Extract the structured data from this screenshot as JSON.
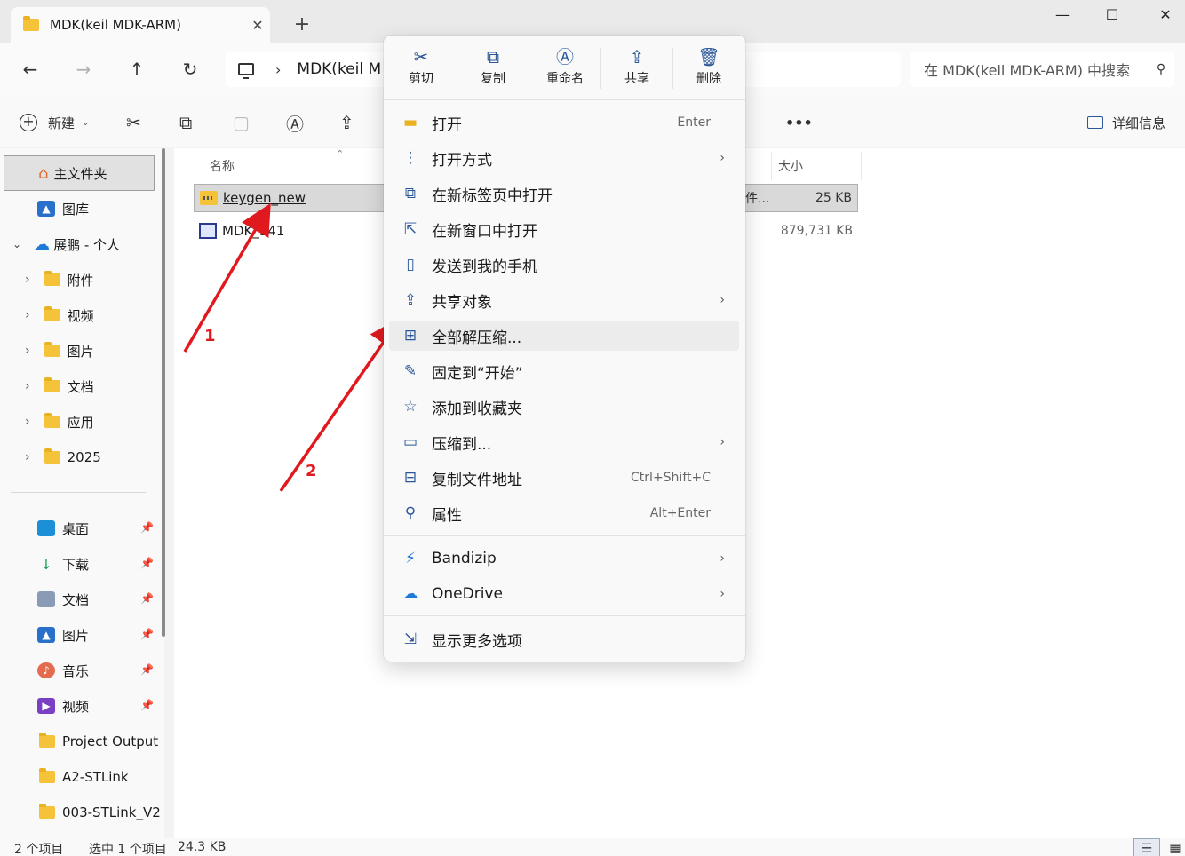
{
  "tab": {
    "title": "MDK(keil MDK-ARM)",
    "close": "✕",
    "new": "+"
  },
  "window": {
    "minimize": "—",
    "maximize": "☐",
    "close": "✕"
  },
  "address": {
    "path": "MDK(keil M",
    "chev": "›",
    "search_placeholder": "在 MDK(keil MDK-ARM) 中搜索"
  },
  "nav": {
    "back": "←",
    "forward": "→",
    "up": "↑",
    "refresh": "↻"
  },
  "commands": {
    "new_label": "新建",
    "more": "•••",
    "details_label": "详细信息"
  },
  "sidebar": {
    "home": "主文件夹",
    "gallery": "图库",
    "onedrive": "展鹏 - 个人",
    "folders": [
      "附件",
      "视频",
      "图片",
      "文档",
      "应用",
      "2025"
    ],
    "quick": [
      "桌面",
      "下载",
      "文档",
      "图片",
      "音乐",
      "视频"
    ],
    "recent": [
      "Project Output",
      "A2-STLink",
      "003-STLink_V2"
    ]
  },
  "columns": {
    "name": "名称",
    "size": "大小"
  },
  "files": [
    {
      "name": "keygen_new",
      "type": "件...",
      "size": "25 KB"
    },
    {
      "name": "MDK_541",
      "type": "",
      "size": "879,731 KB"
    }
  ],
  "status": {
    "count": "2 个项目",
    "selected": "选中 1 个项目",
    "size": "24.3 KB"
  },
  "annotations": {
    "label1": "1",
    "label2": "2"
  },
  "context_menu": {
    "quick_actions": [
      {
        "icon": "✂",
        "label": "剪切"
      },
      {
        "icon": "⧉",
        "label": "复制"
      },
      {
        "icon": "Ⓐ",
        "label": "重命名"
      },
      {
        "icon": "⇪",
        "label": "共享"
      },
      {
        "icon": "🗑",
        "label": "删除"
      }
    ],
    "items": [
      {
        "icon": "▬",
        "label": "打开",
        "shortcut": "Enter",
        "submenu": false
      },
      {
        "icon": "⋮",
        "label": "打开方式",
        "shortcut": "",
        "submenu": true
      },
      {
        "icon": "⧉",
        "label": "在新标签页中打开",
        "shortcut": "",
        "submenu": false
      },
      {
        "icon": "⇱",
        "label": "在新窗口中打开",
        "shortcut": "",
        "submenu": false
      },
      {
        "icon": "▯",
        "label": "发送到我的手机",
        "shortcut": "",
        "submenu": false
      },
      {
        "icon": "⇪",
        "label": "共享对象",
        "shortcut": "",
        "submenu": true
      },
      {
        "icon": "⊞",
        "label": "全部解压缩...",
        "shortcut": "",
        "submenu": false
      },
      {
        "icon": "✎",
        "label": "固定到“开始”",
        "shortcut": "",
        "submenu": false
      },
      {
        "icon": "☆",
        "label": "添加到收藏夹",
        "shortcut": "",
        "submenu": false
      },
      {
        "icon": "▭",
        "label": "压缩到...",
        "shortcut": "",
        "submenu": true
      },
      {
        "icon": "⊟",
        "label": "复制文件地址",
        "shortcut": "Ctrl+Shift+C",
        "submenu": false
      },
      {
        "icon": "⚲",
        "label": "属性",
        "shortcut": "Alt+Enter",
        "submenu": false
      }
    ],
    "apps": [
      {
        "icon": "⚡",
        "label": "Bandizip"
      },
      {
        "icon": "☁",
        "label": "OneDrive"
      }
    ],
    "more": {
      "icon": "⇲",
      "label": "显示更多选项"
    },
    "chev": "›"
  },
  "colors": {
    "accent": "#2b5797",
    "folder": "#f4c339",
    "arrow": "#e0191f"
  }
}
